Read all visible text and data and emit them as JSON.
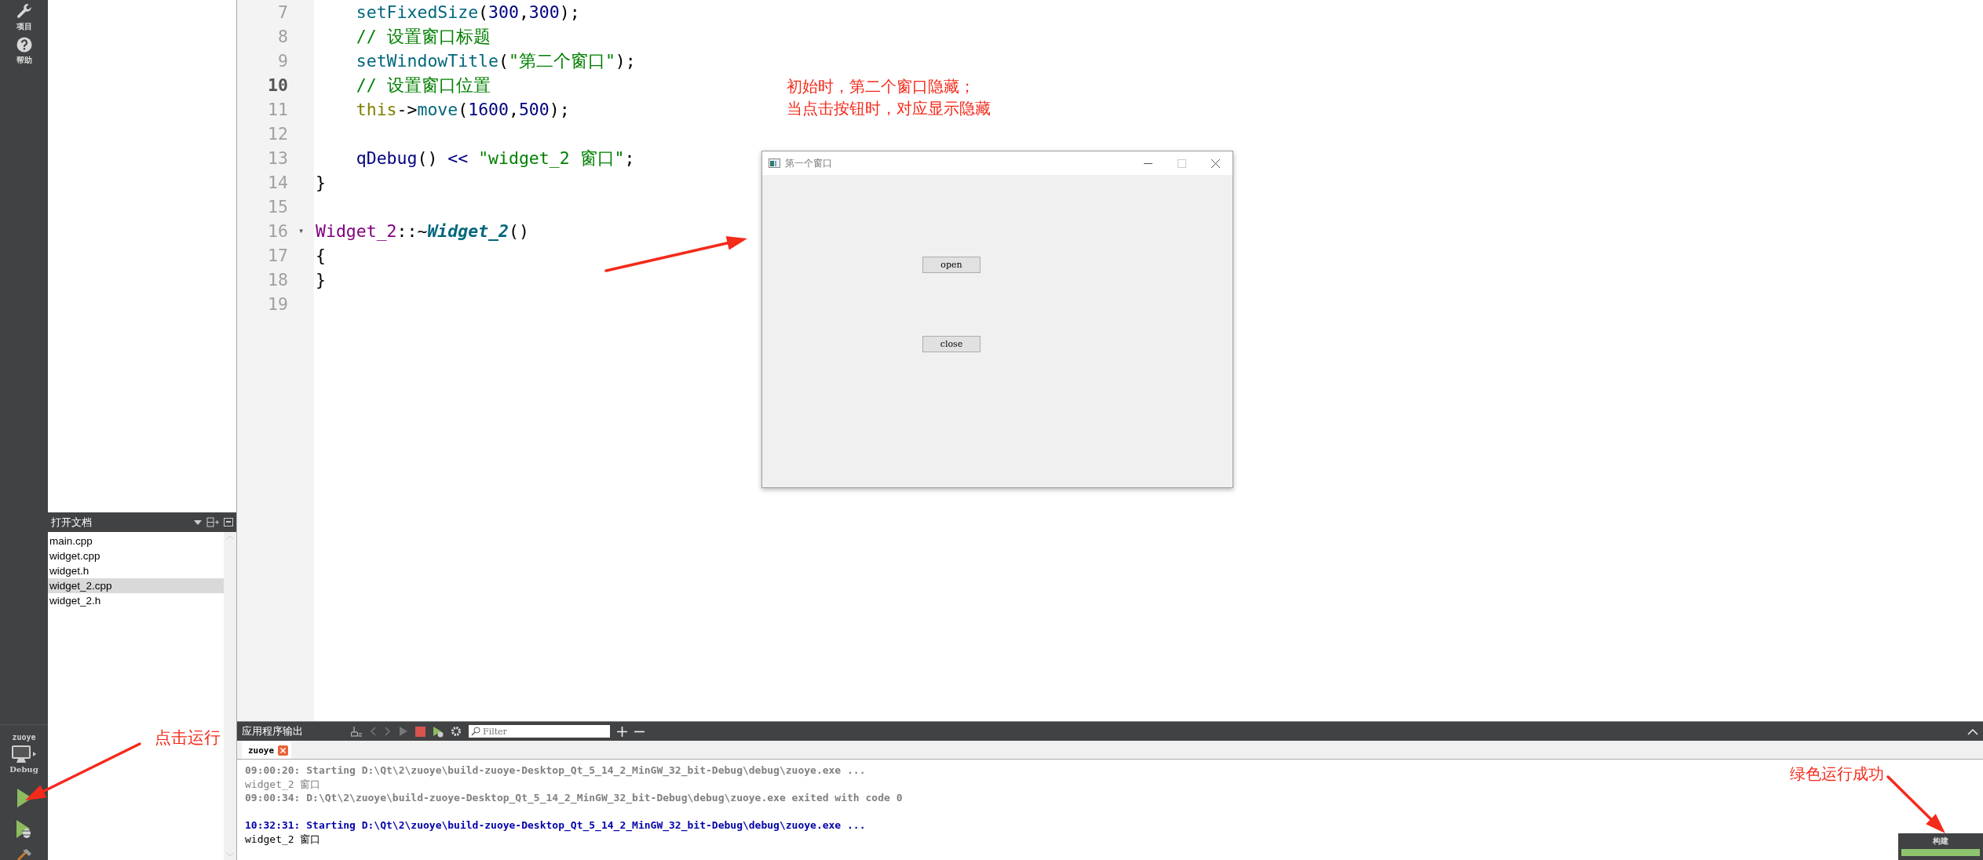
{
  "mode_bar": {
    "top_items": [
      {
        "label": "项目"
      },
      {
        "label": "帮助"
      }
    ],
    "project": "zuoye",
    "build_config": "Debug"
  },
  "open_documents": {
    "title": "打开文档",
    "items": [
      {
        "name": "main.cpp",
        "selected": false
      },
      {
        "name": "widget.cpp",
        "selected": false
      },
      {
        "name": "widget.h",
        "selected": false
      },
      {
        "name": "widget_2.cpp",
        "selected": true
      },
      {
        "name": "widget_2.h",
        "selected": false
      }
    ]
  },
  "editor": {
    "lines": [
      {
        "number": "7",
        "current": false,
        "tokens": [
          {
            "kind": "function",
            "text": "    setFixedSize"
          },
          {
            "kind": "plain",
            "text": "("
          },
          {
            "kind": "number",
            "text": "300"
          },
          {
            "kind": "plain",
            "text": ","
          },
          {
            "kind": "number",
            "text": "300"
          },
          {
            "kind": "plain",
            "text": ");"
          }
        ]
      },
      {
        "number": "8",
        "current": false,
        "tokens": [
          {
            "kind": "comment",
            "text": "    // 设置窗口标题"
          }
        ]
      },
      {
        "number": "9",
        "current": false,
        "tokens": [
          {
            "kind": "function",
            "text": "    setWindowTitle"
          },
          {
            "kind": "plain",
            "text": "("
          },
          {
            "kind": "string",
            "text": "\"第二个窗口\""
          },
          {
            "kind": "plain",
            "text": ");"
          }
        ]
      },
      {
        "number": "10",
        "current": true,
        "tokens": [
          {
            "kind": "comment",
            "text": "    // 设置窗口位置"
          }
        ]
      },
      {
        "number": "11",
        "current": false,
        "tokens": [
          {
            "kind": "keyword",
            "text": "    this"
          },
          {
            "kind": "plain",
            "text": "->"
          },
          {
            "kind": "function",
            "text": "move"
          },
          {
            "kind": "plain",
            "text": "("
          },
          {
            "kind": "number",
            "text": "1600"
          },
          {
            "kind": "plain",
            "text": ","
          },
          {
            "kind": "number",
            "text": "500"
          },
          {
            "kind": "plain",
            "text": ");"
          }
        ]
      },
      {
        "number": "12",
        "current": false
      },
      {
        "number": "13",
        "current": false,
        "tokens": [
          {
            "kind": "number",
            "text": "    qDebug"
          },
          {
            "kind": "plain",
            "text": "() "
          },
          {
            "kind": "number",
            "text": "<< "
          },
          {
            "kind": "string",
            "text": "\"widget_2 窗口\""
          },
          {
            "kind": "plain",
            "text": ";"
          }
        ]
      },
      {
        "number": "14",
        "current": false,
        "tokens": [
          {
            "kind": "plain",
            "text": "}"
          }
        ]
      },
      {
        "number": "15",
        "current": false
      },
      {
        "number": "16",
        "current": false,
        "fold": "▾",
        "tokens": [
          {
            "kind": "class",
            "text": "Widget_2"
          },
          {
            "kind": "plain",
            "text": "::~"
          },
          {
            "kind": "declaration",
            "text": "Widget_2"
          },
          {
            "kind": "plain",
            "text": "()"
          }
        ]
      },
      {
        "number": "17",
        "current": false,
        "tokens": [
          {
            "kind": "plain",
            "text": "{"
          }
        ]
      },
      {
        "number": "18",
        "current": false,
        "tokens": [
          {
            "kind": "plain",
            "text": "}"
          }
        ]
      },
      {
        "number": "19",
        "current": false
      }
    ]
  },
  "dialog": {
    "title": "第一个窗口",
    "buttons": [
      "open",
      "close"
    ]
  },
  "output": {
    "title": "应用程序输出",
    "filter_placeholder": "Filter",
    "tabs": [
      {
        "label": "zuoye",
        "selected": true
      }
    ],
    "lines": [
      {
        "kind": "start_old",
        "text": "09:00:20: Starting D:\\Qt\\2\\zuoye\\build-zuoye-Desktop_Qt_5_14_2_MinGW_32_bit-Debug\\debug\\zuoye.exe ..."
      },
      {
        "kind": "output_old",
        "text": "widget_2 窗口"
      },
      {
        "kind": "start_old",
        "text": "09:00:34: D:\\Qt\\2\\zuoye\\build-zuoye-Desktop_Qt_5_14_2_MinGW_32_bit-Debug\\debug\\zuoye.exe exited with code 0"
      },
      {
        "kind": "blank"
      },
      {
        "kind": "start",
        "text": "10:32:31: Starting D:\\Qt\\2\\zuoye\\build-zuoye-Desktop_Qt_5_14_2_MinGW_32_bit-Debug\\debug\\zuoye.exe ..."
      },
      {
        "kind": "output",
        "text": "widget_2 窗口"
      }
    ]
  },
  "build_progress": {
    "label": "构建",
    "level": 1.0
  },
  "annotations": [
    {
      "text": "初始时，第二个窗口隐藏；"
    },
    {
      "text": "当点击按钮时，对应显示隐藏"
    },
    {
      "text": "点击运行"
    },
    {
      "text": "绿色运行成功"
    }
  ]
}
